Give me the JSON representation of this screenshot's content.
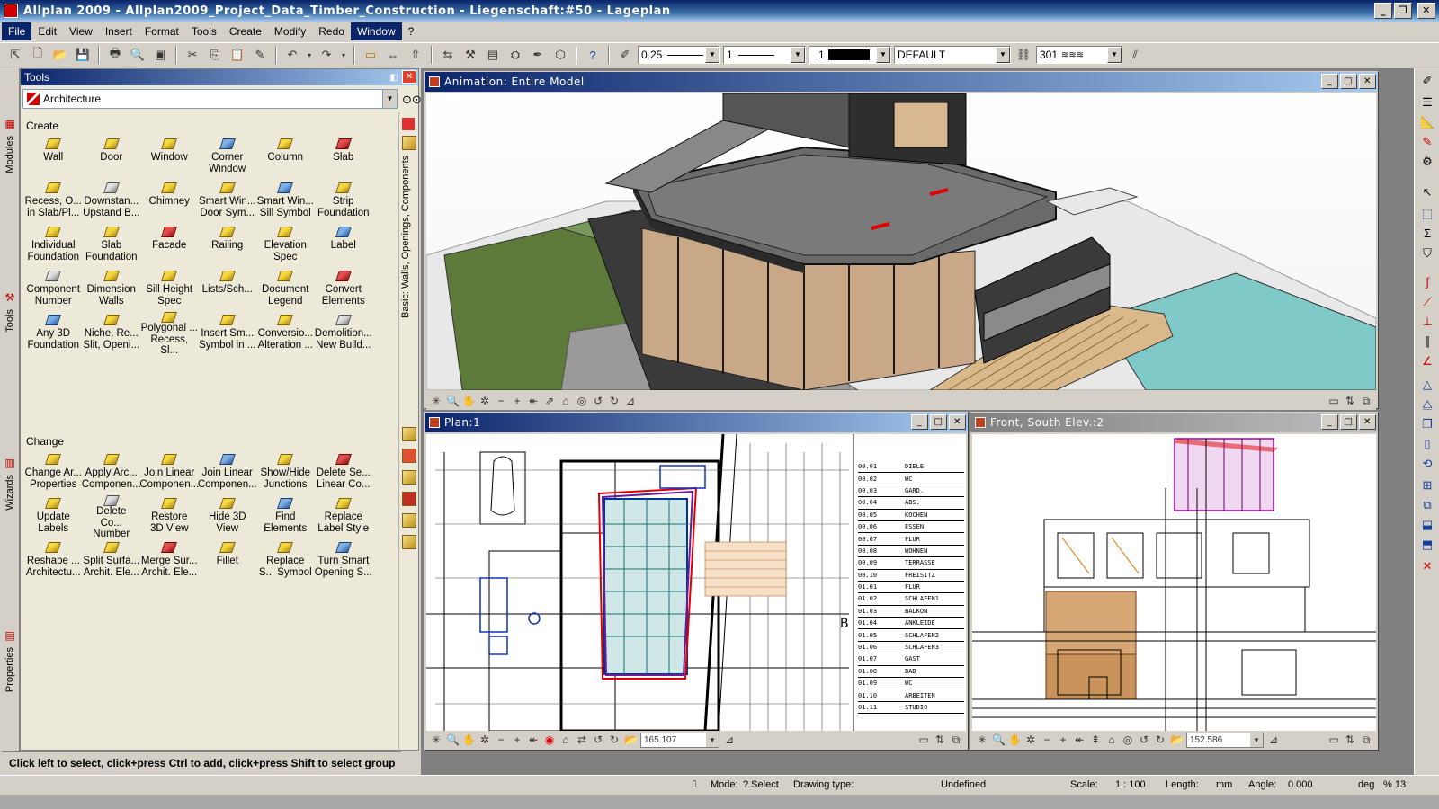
{
  "app": {
    "title": "Allplan 2009 - Allplan2009_Project_Data_Timber_Construction - Liegenschaft:#50 - Lageplan"
  },
  "menu": {
    "items": [
      "File",
      "Edit",
      "View",
      "Insert",
      "Format",
      "Tools",
      "Create",
      "Modify",
      "Redo",
      "Window",
      "?"
    ],
    "active": "Window"
  },
  "toolbar": {
    "pen_value": "0.25",
    "line_value": "1",
    "color_value": "1",
    "layer_value": "DEFAULT",
    "pattern_value": "301"
  },
  "left_tabs": [
    "Modules",
    "Tools",
    "Wizards",
    "Properties"
  ],
  "tools_panel": {
    "title": "Tools",
    "module_select": "Architecture",
    "vertical_label": "Basic: Walls, Openings, Components",
    "create_title": "Create",
    "create_tools": [
      {
        "label": "Wall",
        "icon": "wall-icon"
      },
      {
        "label": "Door",
        "icon": "door-icon"
      },
      {
        "label": "Window",
        "icon": "window-icon"
      },
      {
        "label": "Corner\nWindow",
        "icon": "corner-window-icon"
      },
      {
        "label": "Column",
        "icon": "column-icon"
      },
      {
        "label": "Slab",
        "icon": "slab-icon"
      },
      {
        "label": "Recess, O...\nin Slab/Pl...",
        "icon": "recess-icon"
      },
      {
        "label": "Downstan...\nUpstand B...",
        "icon": "downstand-icon"
      },
      {
        "label": "Chimney",
        "icon": "chimney-icon"
      },
      {
        "label": "Smart Win...\nDoor Sym...",
        "icon": "smart-window-door-icon"
      },
      {
        "label": "Smart Win...\nSill Symbol",
        "icon": "smart-window-sill-icon"
      },
      {
        "label": "Strip\nFoundation",
        "icon": "strip-foundation-icon"
      },
      {
        "label": "Individual\nFoundation",
        "icon": "individual-foundation-icon"
      },
      {
        "label": "Slab\nFoundation",
        "icon": "slab-foundation-icon"
      },
      {
        "label": "Facade",
        "icon": "facade-icon"
      },
      {
        "label": "Railing",
        "icon": "railing-icon"
      },
      {
        "label": "Elevation\nSpec",
        "icon": "elevation-spec-icon"
      },
      {
        "label": "Label",
        "icon": "label-icon"
      },
      {
        "label": "Component\nNumber",
        "icon": "component-number-icon"
      },
      {
        "label": "Dimension\nWalls",
        "icon": "dimension-walls-icon"
      },
      {
        "label": "Sill Height\nSpec",
        "icon": "sill-height-icon"
      },
      {
        "label": "Lists/Sch...",
        "icon": "lists-icon"
      },
      {
        "label": "Document\nLegend",
        "icon": "document-legend-icon"
      },
      {
        "label": "Convert\nElements",
        "icon": "convert-elements-icon"
      },
      {
        "label": "Any 3D\nFoundation",
        "icon": "any-3d-foundation-icon"
      },
      {
        "label": "Niche, Re...\nSlit, Openi...",
        "icon": "niche-icon"
      },
      {
        "label": "Polygonal ...\nRecess, Sl...",
        "icon": "polygonal-recess-icon"
      },
      {
        "label": "Insert Sm...\nSymbol in ...",
        "icon": "insert-smart-symbol-icon"
      },
      {
        "label": "Conversio...\nAlteration ...",
        "icon": "conversion-alteration-icon"
      },
      {
        "label": "Demolition...\nNew Build...",
        "icon": "demolition-icon"
      }
    ],
    "change_title": "Change",
    "change_tools": [
      {
        "label": "Change Ar...\nProperties",
        "icon": "change-properties-icon"
      },
      {
        "label": "Apply Arc...\nComponen...",
        "icon": "apply-arch-icon"
      },
      {
        "label": "Join Linear\nComponen...",
        "icon": "join-linear-icon"
      },
      {
        "label": "Join Linear\nComponen...",
        "icon": "join-linear-2-icon"
      },
      {
        "label": "Show/Hide\nJunctions",
        "icon": "show-hide-junctions-icon"
      },
      {
        "label": "Delete Se...\nLinear Co...",
        "icon": "delete-linear-icon"
      },
      {
        "label": "Update\nLabels",
        "icon": "update-labels-icon"
      },
      {
        "label": "Delete\nCo... Number",
        "icon": "delete-number-icon"
      },
      {
        "label": "Restore\n3D View",
        "icon": "restore-3d-icon"
      },
      {
        "label": "Hide 3D\nView",
        "icon": "hide-3d-icon"
      },
      {
        "label": "Find\nElements",
        "icon": "find-elements-icon"
      },
      {
        "label": "Replace\nLabel Style",
        "icon": "replace-label-style-icon"
      },
      {
        "label": "Reshape ...\nArchitectu...",
        "icon": "reshape-icon"
      },
      {
        "label": "Split Surfa...\nArchit. Ele...",
        "icon": "split-surface-icon"
      },
      {
        "label": "Merge Sur...\nArchit. Ele...",
        "icon": "merge-surface-icon"
      },
      {
        "label": "Fillet",
        "icon": "fillet-icon"
      },
      {
        "label": "Replace\nS... Symbol",
        "icon": "replace-symbol-icon"
      },
      {
        "label": "Turn Smart\nOpening S...",
        "icon": "turn-smart-opening-icon"
      }
    ]
  },
  "windows": {
    "animation": {
      "title": "Animation: Entire Model"
    },
    "plan": {
      "title": "Plan:1",
      "zoom": "165.107"
    },
    "front": {
      "title": "Front, South Elev.:2",
      "zoom": "152.586"
    }
  },
  "room_list": [
    {
      "no": "00.01",
      "name": "DIELE"
    },
    {
      "no": "00.02",
      "name": "WC"
    },
    {
      "no": "00.03",
      "name": "GARD."
    },
    {
      "no": "00.04",
      "name": "ABS."
    },
    {
      "no": "00.05",
      "name": "KOCHEN"
    },
    {
      "no": "00.06",
      "name": "ESSEN"
    },
    {
      "no": "00.07",
      "name": "FLUR"
    },
    {
      "no": "00.08",
      "name": "WOHNEN"
    },
    {
      "no": "00.09",
      "name": "TERRASSE"
    },
    {
      "no": "00.10",
      "name": "FREISITZ"
    },
    {
      "no": "01.01",
      "name": "FLUR"
    },
    {
      "no": "01.02",
      "name": "SCHLAFEN1"
    },
    {
      "no": "01.03",
      "name": "BALKON"
    },
    {
      "no": "01.04",
      "name": "ANKLEIDE"
    },
    {
      "no": "01.05",
      "name": "SCHLAFEN2"
    },
    {
      "no": "01.06",
      "name": "SCHLAFEN3"
    },
    {
      "no": "01.07",
      "name": "GAST"
    },
    {
      "no": "01.08",
      "name": "BAD"
    },
    {
      "no": "01.09",
      "name": "WC"
    },
    {
      "no": "01.10",
      "name": "ARBEITEN"
    },
    {
      "no": "01.11",
      "name": "STUDIO"
    }
  ],
  "status": {
    "hint": "Click left to select, click+press Ctrl to add, click+press Shift to select group",
    "mode_label": "Mode:",
    "mode_value": "? Select",
    "drawing_type_label": "Drawing type:",
    "drawing_type_value": "Undefined",
    "scale_label": "Scale:",
    "scale_value": "1 : 100",
    "length_label": "Length:",
    "length_value": "mm",
    "angle_label": "Angle:",
    "angle_value": "0.000",
    "angle_unit": "deg",
    "percent_value": "% 13"
  }
}
